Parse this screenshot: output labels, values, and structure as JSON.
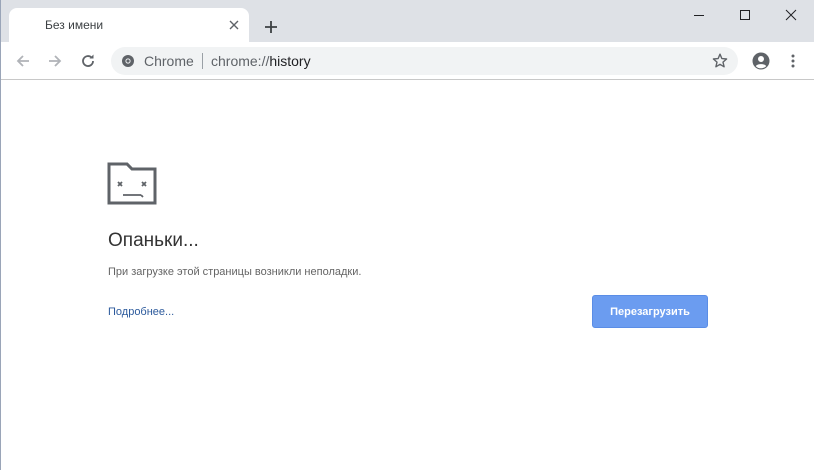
{
  "tab": {
    "title": "Без имени"
  },
  "omnibox": {
    "chip_label": "Chrome",
    "url_scheme": "chrome://",
    "url_host": "history"
  },
  "error_page": {
    "heading": "Опаньки...",
    "message": "При загрузке этой страницы возникли неполадки.",
    "details_link": "Подробнее...",
    "reload_label": "Перезагрузить"
  },
  "icons": {
    "tab_close": "close-icon",
    "new_tab": "plus-icon",
    "minimize": "minimize-icon",
    "maximize": "maximize-icon",
    "window_close": "close-icon",
    "back": "arrow-left-icon",
    "forward": "arrow-right-icon",
    "reload": "reload-icon",
    "site_info": "chrome-icon",
    "bookmark": "star-icon",
    "profile": "account-icon",
    "menu": "more-vert-icon",
    "sad_tab": "sad-folder-icon"
  },
  "colors": {
    "tabstrip_bg": "#dee1e6",
    "omnibox_bg": "#f1f3f4",
    "reload_button": "#6b9cf0",
    "link": "#2c5a9c"
  }
}
